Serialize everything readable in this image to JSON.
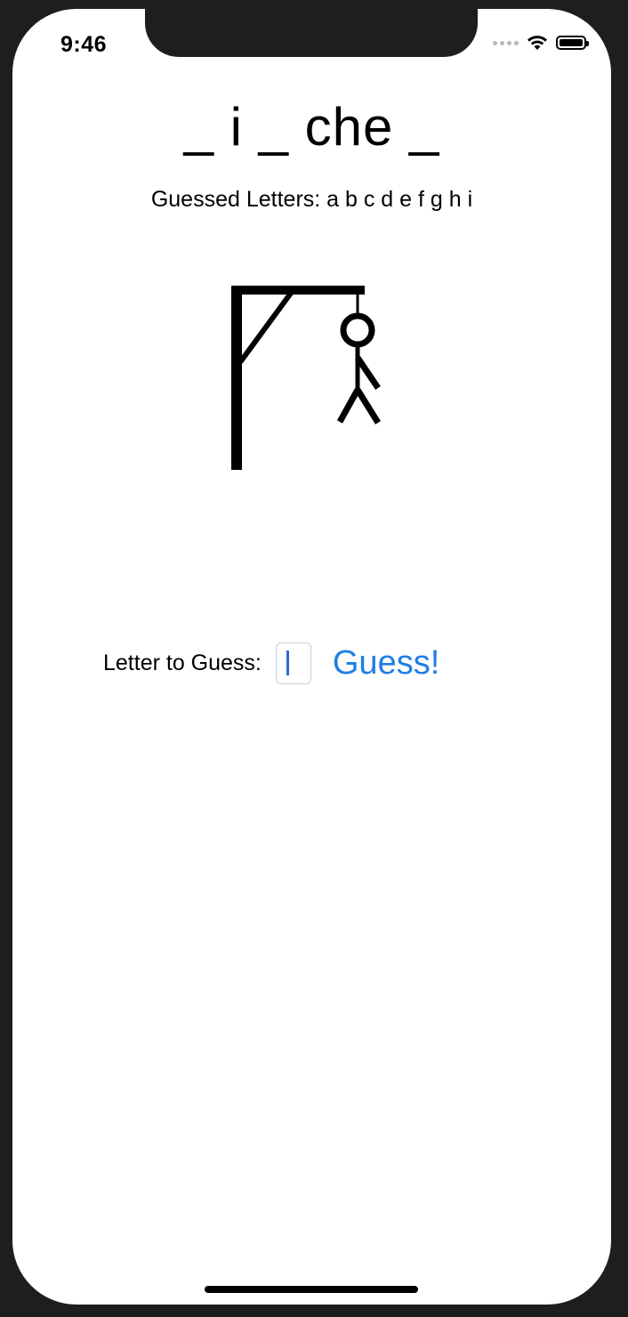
{
  "status_bar": {
    "time": "9:46",
    "icons": [
      "signal-dots-icon",
      "wifi-icon",
      "battery-icon"
    ]
  },
  "game": {
    "word_display": "_ i _ che _",
    "guessed_letters_label": "Guessed Letters: a b c d e f g h i",
    "hangman_icon": "hangman-gallows-icon"
  },
  "guess": {
    "label": "Letter to Guess:",
    "input_value": "",
    "button_label": "Guess!"
  },
  "colors": {
    "accent": "#1f7ee6",
    "caret": "#2f6bd9"
  }
}
